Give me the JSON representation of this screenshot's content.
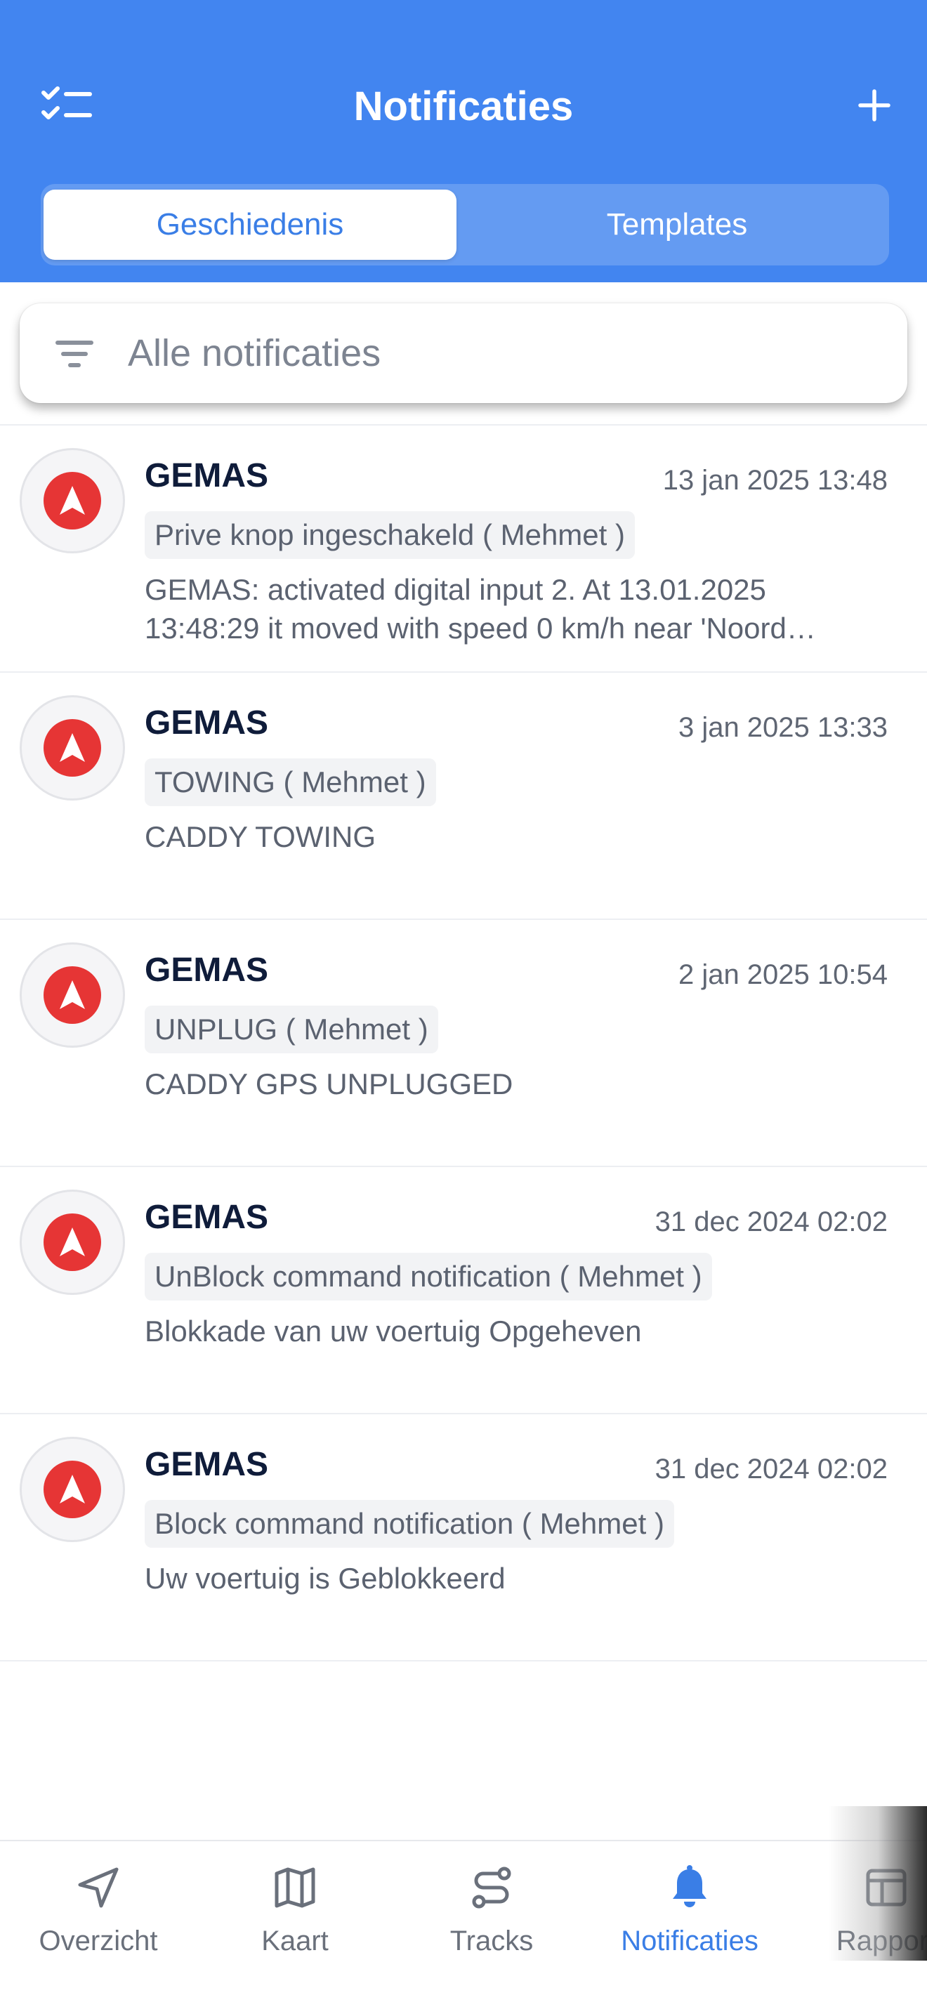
{
  "header": {
    "title": "Notificaties",
    "tabs": [
      {
        "label": "Geschiedenis",
        "active": true
      },
      {
        "label": "Templates",
        "active": false
      }
    ]
  },
  "filter": {
    "placeholder": "Alle notificaties"
  },
  "notifications": [
    {
      "title": "GEMAS",
      "date": "13 jan 2025 13:48",
      "tag": "Prive knop ingeschakeld ( Mehmet )",
      "message": "GEMAS: activated digital input 2. At 13.01.2025 13:48:29 it moved with speed 0 km/h near 'Noord…"
    },
    {
      "title": "GEMAS",
      "date": "3 jan 2025 13:33",
      "tag": "TOWING ( Mehmet )",
      "message": "CADDY TOWING"
    },
    {
      "title": "GEMAS",
      "date": "2 jan 2025 10:54",
      "tag": "UNPLUG ( Mehmet )",
      "message": "CADDY GPS UNPLUGGED"
    },
    {
      "title": "GEMAS",
      "date": "31 dec 2024 02:02",
      "tag": "UnBlock command notification ( Mehmet )",
      "message": "Blokkade van uw voertuig Opgeheven"
    },
    {
      "title": "GEMAS",
      "date": "31 dec 2024 02:02",
      "tag": "Block command notification ( Mehmet )",
      "message": "Uw voertuig is Geblokkeerd"
    }
  ],
  "tabbar": {
    "items": [
      {
        "label": "Overzicht",
        "icon": "navigation-arrow-icon"
      },
      {
        "label": "Kaart",
        "icon": "map-icon"
      },
      {
        "label": "Tracks",
        "icon": "route-icon"
      },
      {
        "label": "Notificaties",
        "icon": "bell-icon",
        "active": true
      },
      {
        "label": "Rapport",
        "icon": "table-icon"
      }
    ]
  },
  "colors": {
    "primary": "#4285f0",
    "accent": "#3a7ee6",
    "alert": "#e63535"
  }
}
